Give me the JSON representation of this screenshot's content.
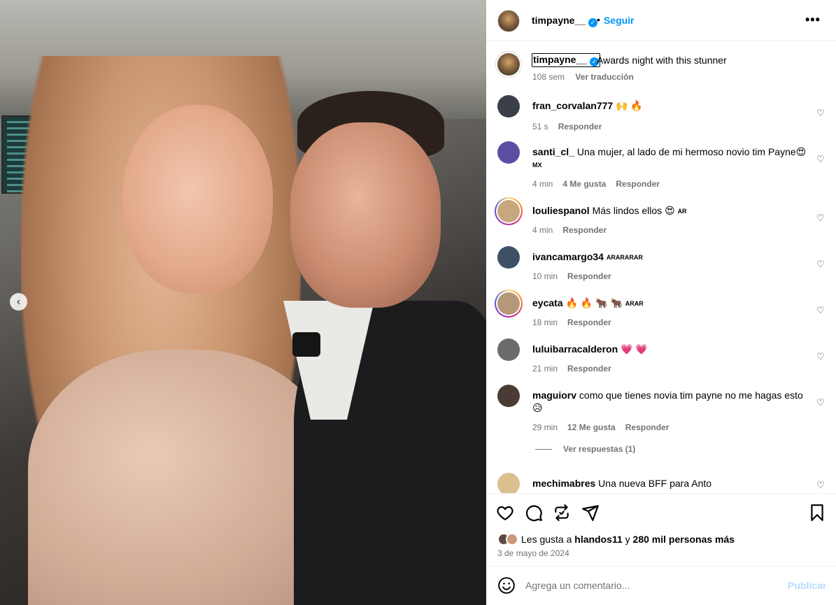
{
  "post": {
    "author": "timpayne__",
    "verified": true,
    "follow_label": "Seguir",
    "dot": "•",
    "more_label": "•••",
    "caption": {
      "username": "timpayne__",
      "text": "Awards night with this stunner",
      "time": "108 sem",
      "translate_label": "Ver traducción"
    }
  },
  "comments": [
    {
      "username": "fran_corvalan777",
      "text": "🙌 🔥",
      "flag": "",
      "time": "51 s",
      "likes": "",
      "reply_label": "Responder",
      "avatar_color": "#3b3f4a",
      "story": false
    },
    {
      "username": "santi_cl_",
      "text": "Una mujer, al lado de mi hermoso novio tim Payne😍",
      "flag": "MX",
      "time": "4 min",
      "likes": "4 Me gusta",
      "reply_label": "Responder",
      "avatar_color": "#5a4fa3",
      "story": false
    },
    {
      "username": "louliespanol",
      "text": "Más lindos ellos 😍",
      "flag": "AR",
      "time": "4 min",
      "likes": "",
      "reply_label": "Responder",
      "avatar_color": "#c7a77d",
      "story": true
    },
    {
      "username": "ivancamargo34",
      "text": "",
      "flag": "ARARARAR",
      "time": "10 min",
      "likes": "",
      "reply_label": "Responder",
      "avatar_color": "#3e4f66",
      "story": false
    },
    {
      "username": "eycata",
      "text": "🔥 🔥 🐂 🐂",
      "flag": "ARAR",
      "time": "18 min",
      "likes": "",
      "reply_label": "Responder",
      "avatar_color": "#b5987a",
      "story": true
    },
    {
      "username": "luluibarracalderon",
      "text": "💗 💗",
      "flag": "",
      "time": "21 min",
      "likes": "",
      "reply_label": "Responder",
      "avatar_color": "#6b6b6b",
      "story": false
    },
    {
      "username": "maguiorv",
      "text": "como que tienes novia tim payne no me hagas esto 😥",
      "flag": "",
      "time": "29 min",
      "likes": "12 Me gusta",
      "reply_label": "Responder",
      "avatar_color": "#4a3c35",
      "story": false
    },
    {
      "username": "mechimabres",
      "text": "Una nueva BFF para Anto",
      "flag": "",
      "time": "",
      "likes": "",
      "reply_label": "",
      "avatar_color": "#d9c08e",
      "story": false
    }
  ],
  "view_replies_label": "Ver respuestas (1)",
  "likes": {
    "prefix": "Les gusta a ",
    "user": "hlandos11",
    "joiner": " y ",
    "count": "280 mil personas más"
  },
  "date": "3 de mayo de 2024",
  "composer": {
    "placeholder": "Agrega un comentario...",
    "post_label": "Publicar"
  },
  "colors": {
    "accent": "#0095f6",
    "post_disabled": "#b3dbff",
    "muted": "#737373"
  },
  "icons": [
    "chevron-left-icon",
    "verified-icon",
    "more-icon",
    "heart-icon",
    "comment-icon",
    "repost-icon",
    "share-icon",
    "bookmark-icon",
    "emoji-icon"
  ]
}
